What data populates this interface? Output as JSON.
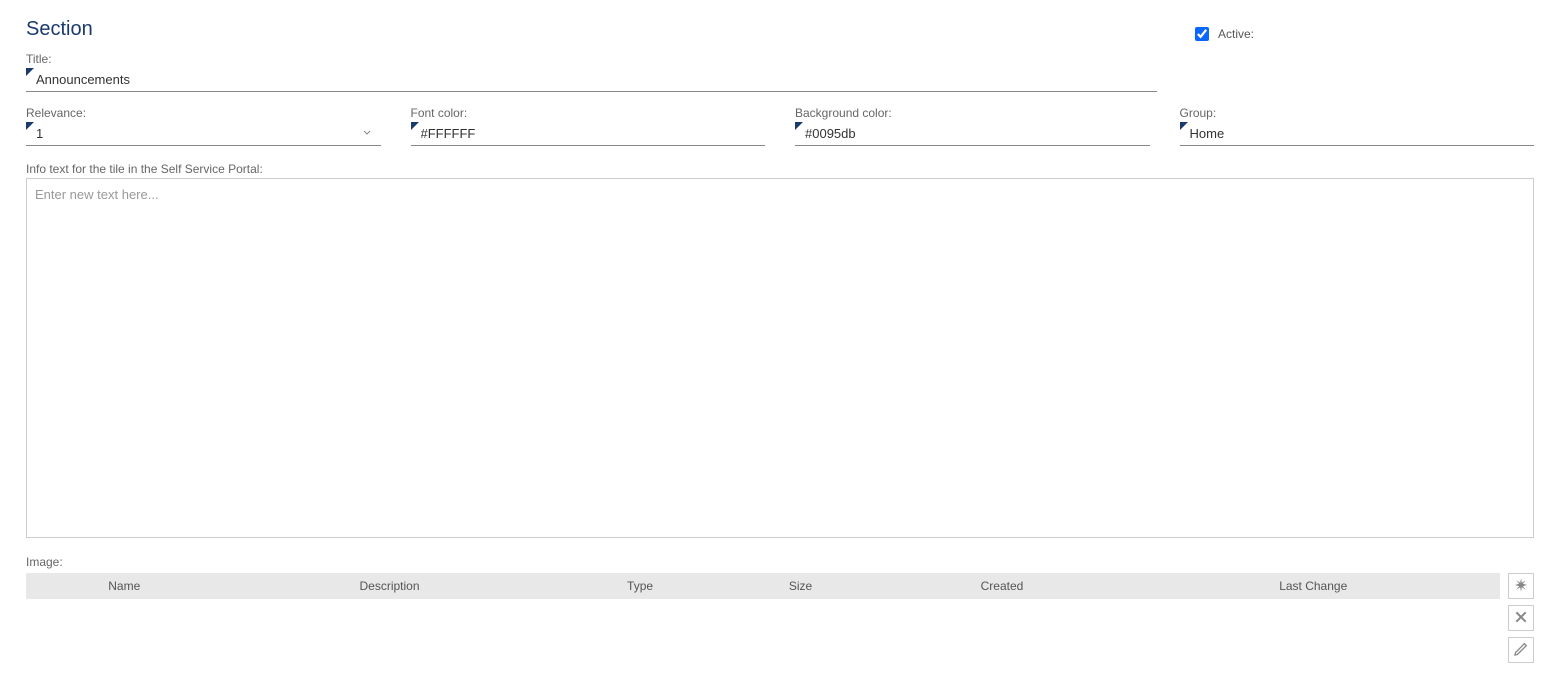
{
  "header": {
    "title": "Section",
    "active_label": "Active:",
    "active_checked": true
  },
  "fields": {
    "title_label": "Title:",
    "title_value": "Announcements",
    "relevance_label": "Relevance:",
    "relevance_value": "1",
    "font_color_label": "Font color:",
    "font_color_value": "#FFFFFF",
    "bg_color_label": "Background color:",
    "bg_color_value": "#0095db",
    "group_label": "Group:",
    "group_value": "Home",
    "info_label": "Info text for the tile in the Self Service Portal:",
    "info_placeholder": "Enter new text here...",
    "info_value": ""
  },
  "image_section": {
    "label": "Image:",
    "columns": [
      "Name",
      "Description",
      "Type",
      "Size",
      "Created",
      "Last Change"
    ]
  },
  "icons": {
    "add": "add-icon",
    "remove": "remove-icon",
    "edit": "edit-icon"
  }
}
